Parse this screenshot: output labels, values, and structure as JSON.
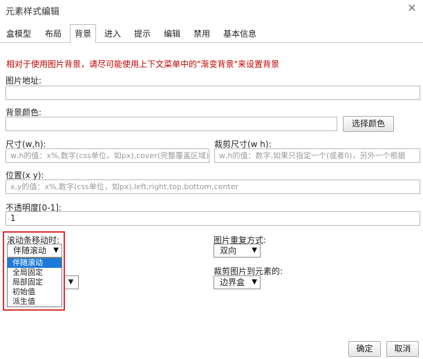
{
  "dialog": {
    "title": "元素样式编辑",
    "close_icon": "close-icon"
  },
  "tabs": [
    {
      "label": "盒模型"
    },
    {
      "label": "布局"
    },
    {
      "label": "背景",
      "active": true
    },
    {
      "label": "进入"
    },
    {
      "label": "提示"
    },
    {
      "label": "编辑"
    },
    {
      "label": "禁用"
    },
    {
      "label": "基本信息"
    }
  ],
  "hint": "相对于使用图片背景，请尽可能使用上下文菜单中的\"渐变背景\"来设置背景",
  "image_url": {
    "label": "图片地址:",
    "value": ""
  },
  "bg_color": {
    "label": "背景颜色:",
    "value": "",
    "pick_button": "选择颜色"
  },
  "size": {
    "label": "尺寸(w,h):",
    "placeholder": "w,h的值：x%,数字(css单位，如px),cover(完整覆盖区域)"
  },
  "crop_size": {
    "label": "裁剪尺寸(w h):",
    "placeholder": "w,h的值：数字,如果只指定一个(或者0)，另外一个根据"
  },
  "position": {
    "label": "位置(x y):",
    "placeholder": "x,y的值：x%,数字(css单位，如px),left,right,top,bottom,center"
  },
  "opacity": {
    "label": "不透明度[0-1]:",
    "value": "1"
  },
  "scroll": {
    "label": "滚动条移动时:",
    "selected": "伴随滚动",
    "options": [
      "伴随滚动",
      "全局固定",
      "局部固定",
      "初始值",
      "派生值"
    ]
  },
  "repeat": {
    "label": "图片重复方式:",
    "selected": "双向"
  },
  "clip": {
    "label": "裁剪图片到元素的:",
    "selected": "边界盒"
  },
  "footer": {
    "ok": "确定",
    "cancel": "取消"
  },
  "colors": {
    "hint": "#c00000",
    "highlight_box": "#d7312f",
    "selected_option": "#1e7ad8"
  }
}
